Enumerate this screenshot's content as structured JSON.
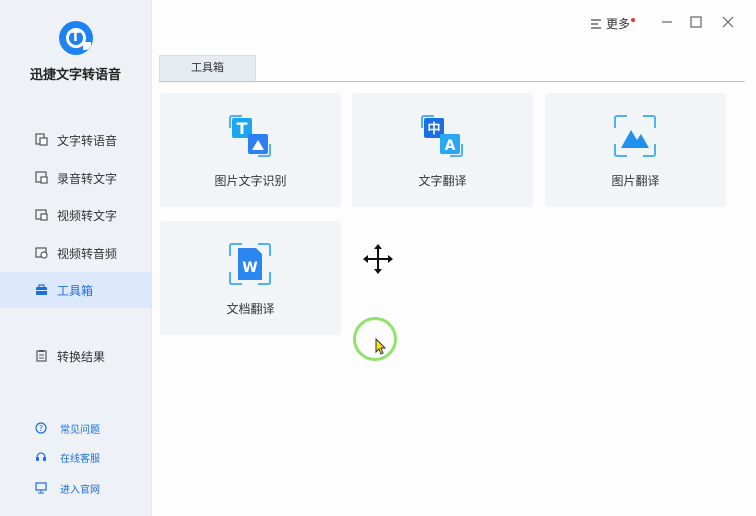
{
  "app": {
    "title": "迅捷文字转语音"
  },
  "sidebar": {
    "items": [
      {
        "label": "文字转语音",
        "icon": "text-doc-icon",
        "active": false
      },
      {
        "label": "录音转文字",
        "icon": "record-icon",
        "active": false
      },
      {
        "label": "视频转文字",
        "icon": "video-icon",
        "active": false
      },
      {
        "label": "视频转音频",
        "icon": "video-audio-icon",
        "active": false
      },
      {
        "label": "工具箱",
        "icon": "toolbox-icon",
        "active": true
      }
    ],
    "result": {
      "label": "转换结果",
      "icon": "clipboard-icon"
    },
    "bottom": [
      {
        "label": "常见问题",
        "icon": "question-icon"
      },
      {
        "label": "在线客服",
        "icon": "headset-icon"
      },
      {
        "label": "进入官网",
        "icon": "monitor-icon"
      }
    ]
  },
  "topbar": {
    "more_label": "更多"
  },
  "tabs": [
    {
      "label": "工具箱",
      "active": true
    }
  ],
  "tools": [
    {
      "label": "图片文字识别",
      "icon": "image-text-ocr-icon",
      "glyph": "T"
    },
    {
      "label": "文字翻译",
      "icon": "text-translate-icon",
      "glyph1": "中",
      "glyph2": "A"
    },
    {
      "label": "图片翻译",
      "icon": "image-translate-icon"
    },
    {
      "label": "文档翻译",
      "icon": "doc-translate-icon",
      "glyph": "W"
    }
  ],
  "colors": {
    "accent": "#1b6fe0",
    "sidebar_bg": "#eef2f6",
    "active_bg": "#dce8fb",
    "cursor_ring": "#8fe36a"
  }
}
